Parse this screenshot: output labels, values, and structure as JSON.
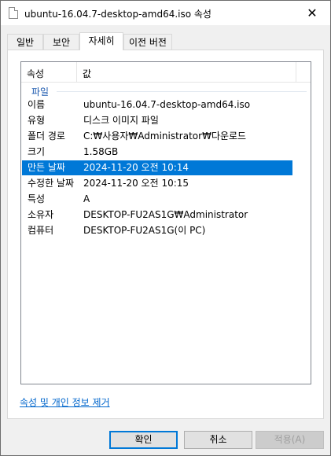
{
  "window": {
    "title": "ubuntu-16.04.7-desktop-amd64.iso 속성",
    "close_glyph": "✕"
  },
  "tabs": [
    {
      "label": "일반"
    },
    {
      "label": "보안"
    },
    {
      "label": "자세히"
    },
    {
      "label": "이전 버전"
    }
  ],
  "details": {
    "columns": {
      "property": "속성",
      "value": "값"
    },
    "group": "파일",
    "rows": [
      {
        "key": "이름",
        "value": "ubuntu-16.04.7-desktop-amd64.iso"
      },
      {
        "key": "유형",
        "value": "디스크 이미지 파일"
      },
      {
        "key": "폴더 경로",
        "value": "C:₩사용자₩Administrator₩다운로드"
      },
      {
        "key": "크기",
        "value": "1.58GB"
      },
      {
        "key": "만든 날짜",
        "value": "2024-11-20 오전 10:14"
      },
      {
        "key": "수정한 날짜",
        "value": "2024-11-20 오전 10:15"
      },
      {
        "key": "특성",
        "value": "A"
      },
      {
        "key": "소유자",
        "value": "DESKTOP-FU2AS1G₩Administrator"
      },
      {
        "key": "컴퓨터",
        "value": "DESKTOP-FU2AS1G(이 PC)"
      }
    ],
    "selected_index": 4
  },
  "remove_link": "속성 및 개인 정보 제거",
  "buttons": {
    "ok": "확인",
    "cancel": "취소",
    "apply": "적용(A)"
  }
}
